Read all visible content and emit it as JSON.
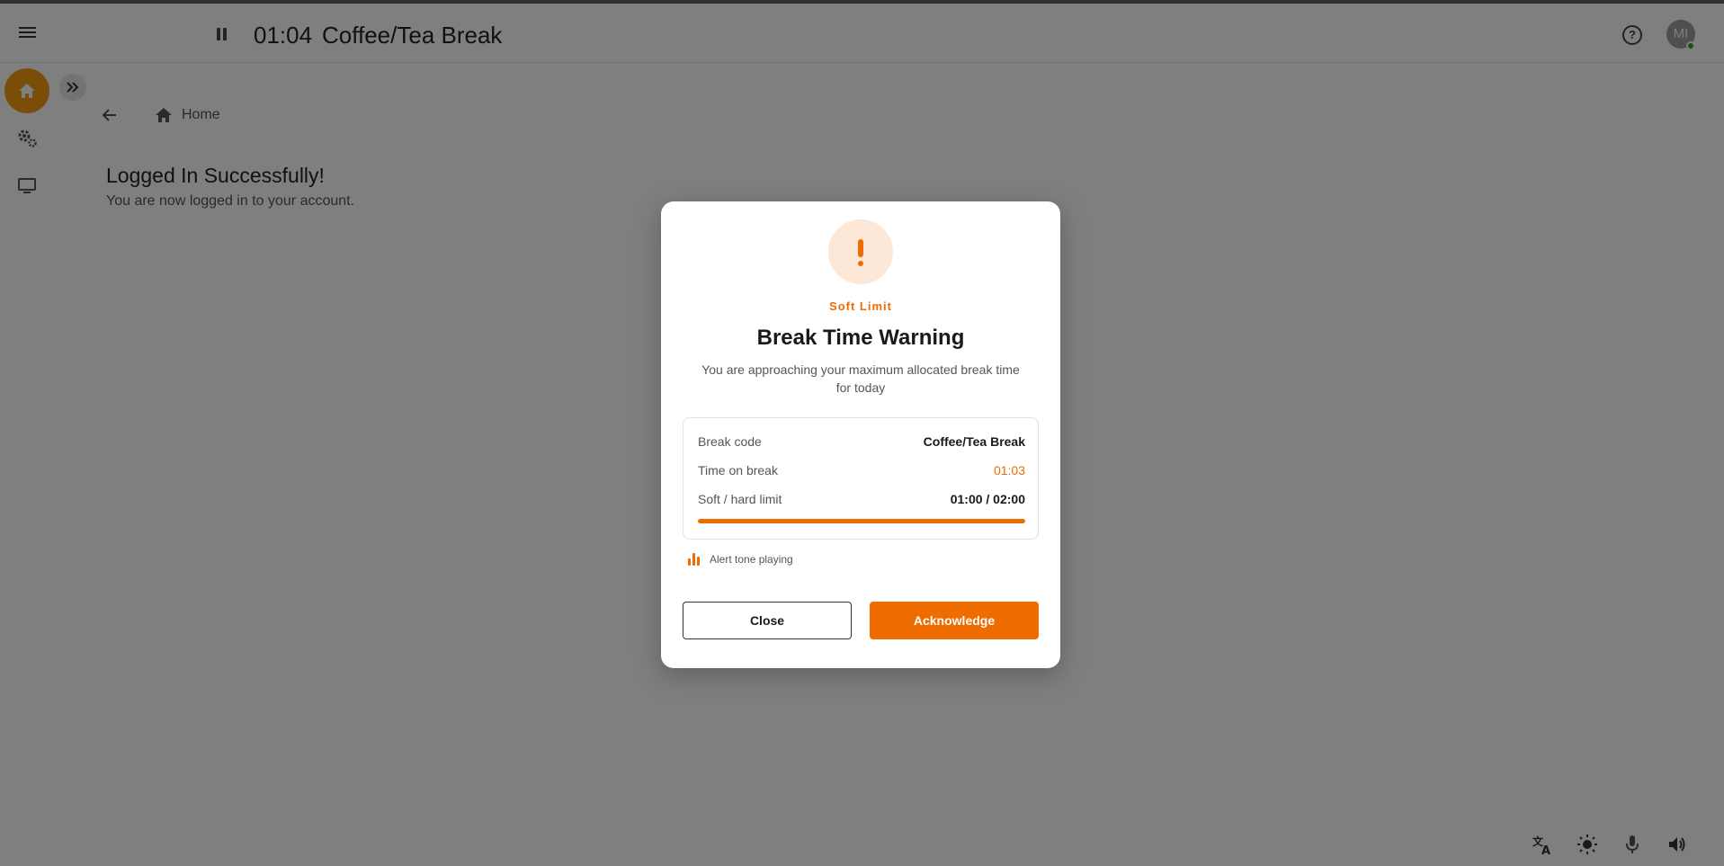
{
  "header": {
    "timer": "01:04",
    "break_name": "Coffee/Tea Break",
    "avatar_initials": "MI"
  },
  "breadcrumb": {
    "home_label": "Home"
  },
  "main": {
    "title": "Logged In Successfully!",
    "subtitle": "You are now logged in to your account."
  },
  "dialog": {
    "eyebrow": "Soft Limit",
    "title": "Break Time Warning",
    "description": "You are approaching your maximum allocated break time for today",
    "rows": [
      {
        "label": "Break code",
        "value": "Coffee/Tea Break"
      },
      {
        "label": "Time on break",
        "value": "01:03"
      },
      {
        "label": "Soft / hard limit",
        "value": "01:00 / 02:00"
      }
    ],
    "progress_fraction": 1.0,
    "alert_text": "Alert tone playing",
    "close_label": "Close",
    "acknowledge_label": "Acknowledge"
  },
  "colors": {
    "accent": "#ef6c00",
    "rail_home": "#f39c12",
    "status_online": "#2ea043"
  },
  "icons": {
    "menu": "hamburger-menu-icon",
    "pause": "pause-icon",
    "help": "help-icon",
    "home": "home-icon",
    "settings": "settings-gears-icon",
    "monitor": "monitor-icon",
    "expand": "double-chevron-right-icon",
    "back": "arrow-back-icon",
    "translate": "translate-icon",
    "brightness": "brightness-icon",
    "mic": "microphone-icon",
    "volume": "volume-icon",
    "warning": "exclamation-icon",
    "equalizer": "equalizer-icon"
  }
}
